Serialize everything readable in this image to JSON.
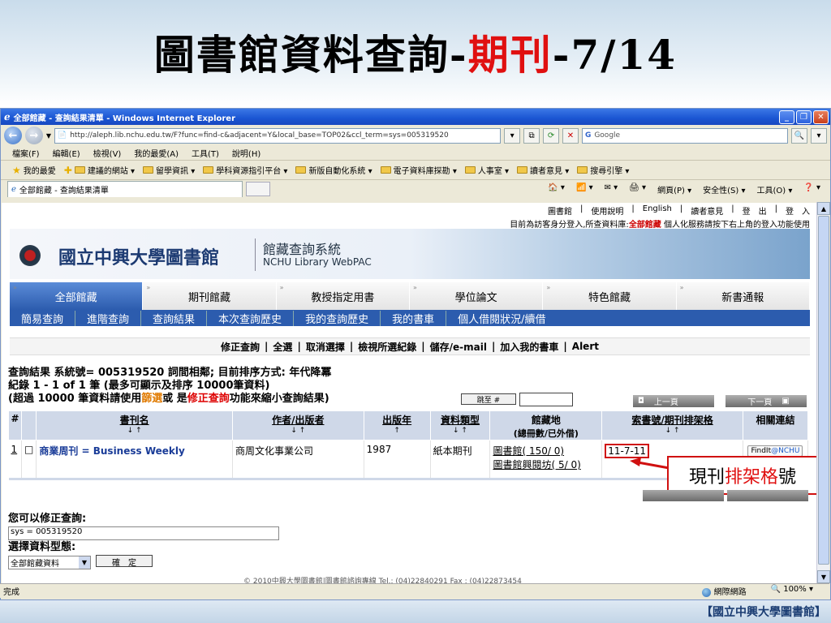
{
  "slide": {
    "title_prefix": "圖書館資料查詢-",
    "title_highlight": "期刊",
    "title_suffix": "-7/14",
    "footer_brand": "【國立中興大學圖書館】"
  },
  "browser": {
    "window_title": "全部館藏 - 查詢結果清單 - Windows Internet Explorer",
    "url": "http://aleph.lib.nchu.edu.tw/F?func=find-c&adjacent=Y&local_base=TOP02&ccl_term=sys=005319520",
    "search_placeholder": "Google",
    "menu": [
      "檔案(F)",
      "編輯(E)",
      "檢視(V)",
      "我的最愛(A)",
      "工具(T)",
      "說明(H)"
    ],
    "favorites_label": "我的最愛",
    "favorites": [
      "建議的網站 ▾",
      "留學資訊 ▾",
      "學科資源指引平台 ▾",
      "新版自動化系統 ▾",
      "電子資料庫探勘 ▾",
      "人事室 ▾",
      "讀者意見 ▾",
      "搜尋引擎 ▾"
    ],
    "tab_title": "全部館藏 - 查詢結果清單",
    "toolbar_right": [
      "網頁(P) ▾",
      "安全性(S) ▾",
      "工具(O) ▾",
      "❓ ▾"
    ],
    "status_left": "完成",
    "status_zone": "網際網路",
    "status_zoom": "🔍 100%  ▾"
  },
  "webpac": {
    "top_links": [
      "圖書館",
      "使用說明",
      "English",
      "讀者意見",
      "登　出",
      "登　入"
    ],
    "top_note_prefix": "目前為訪客身分登入,所查資料庫:",
    "top_note_db": "全部館藏",
    "top_note_suffix": " 個人化服務請按下右上角的登入功能使用",
    "library_name": "國立中興大學圖書館",
    "system_name": "館藏查詢系統",
    "system_name_en": "NCHU Library WebPAC",
    "main_tabs": [
      "全部館藏",
      "期刊館藏",
      "教授指定用書",
      "學位論文",
      "特色館藏",
      "新書通報"
    ],
    "sub_nav": [
      "簡易查詢",
      "進階查詢",
      "查詢結果",
      "本次查詢歷史",
      "我的查詢歷史",
      "我的書車",
      "個人借閱狀況/續借"
    ],
    "actions": [
      "修正查詢",
      "全選",
      "取消選擇",
      "檢視所選紀錄",
      "儲存/e-mail",
      "加入我的書車",
      "Alert"
    ],
    "result_line1": "查詢結果 系統號= 005319520 詞間相鄰; 目前排序方式: 年代降冪",
    "result_line2": "紀錄 1 - 1 of 1 筆 (最多可顯示及排序 10000筆資料)",
    "result_line3_a": "(超過 10000 筆資料請使用",
    "result_line3_filter": "篩選",
    "result_line3_b": "或 是",
    "result_line3_modify": "修正查詢",
    "result_line3_c": "功能來縮小查詢結果)",
    "jump_label": "跳至 #",
    "prev_page": "上一頁",
    "next_page": "下一頁",
    "table_headers": {
      "num": "#",
      "title": "書刊名",
      "author": "作者/出版者",
      "year": "出版年",
      "type": "資料類型",
      "location": "館藏地",
      "location_sub": "(總冊數/已外借)",
      "callno": "索書號/期刊排架格",
      "links": "相關連結",
      "sort_arrows": "↓ ↑",
      "sort_up": "↑"
    },
    "record": {
      "num": "1",
      "checkbox": "□",
      "title": "商業周刊 = Business Weekly",
      "publisher": "商周文化事業公司",
      "year": "1987",
      "type": "紙本期刊",
      "location1": "圖書館( 150/ 0)",
      "location2": "圖書館興閱坊( 5/ 0)",
      "callno": "11-7-11",
      "findit_a": "FindIt",
      "findit_b": "@NCHU"
    },
    "modify_label": "您可以修正查詢:",
    "modify_value": "sys = 005319520",
    "type_label": "選擇資料型態:",
    "type_value": "全部館藏資料",
    "confirm": "確　定",
    "footer": "© 2010中興大學圖書館|圖書館諮詢專線 Tel.: (04)22840291 Fax : (04)22873454"
  },
  "annotation": {
    "prefix": "現刊",
    "highlight": "排架格",
    "suffix": "號"
  }
}
